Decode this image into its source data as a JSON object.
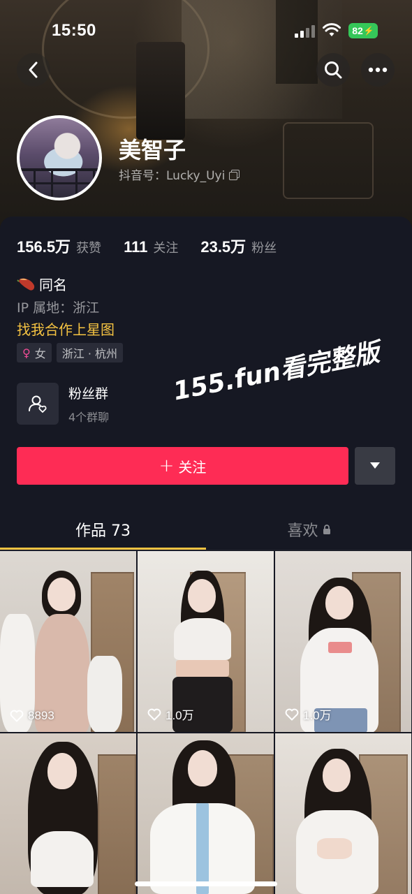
{
  "status_bar": {
    "time": "15:50",
    "battery": "82"
  },
  "profile": {
    "name": "美智子",
    "douyin_id": "抖音号：Lucky_Uyi"
  },
  "stats": [
    {
      "value": "156.5万",
      "label": "获赞"
    },
    {
      "value": "111",
      "label": "关注"
    },
    {
      "value": "23.5万",
      "label": "粉丝"
    }
  ],
  "bio": {
    "line1": "同名",
    "ip": "IP 属地：浙江",
    "collab": "找我合作上星图",
    "tags": {
      "gender": "女",
      "location": "浙江 · 杭州"
    }
  },
  "fan_group": {
    "title": "粉丝群",
    "subtitle": "4个群聊"
  },
  "watermark": "155.fun看完整版",
  "follow_button": {
    "plus": "+",
    "label": "关注"
  },
  "tabs": {
    "works": "作品 73",
    "likes": "喜欢"
  },
  "videos": [
    {
      "likes": "8893"
    },
    {
      "likes": "1.0万"
    },
    {
      "likes": "1.0万"
    },
    {
      "likes": ""
    },
    {
      "likes": ""
    },
    {
      "likes": ""
    }
  ],
  "colors": {
    "accent": "#fe2c55",
    "tab_underline": "#f5c342",
    "collab_text": "#f5c342",
    "background": "#161823",
    "battery": "#35c759"
  },
  "icons": {
    "back": "chevron-left-icon",
    "search": "search-icon",
    "more": "more-icon",
    "copy": "copy-icon",
    "fan_group": "group-icon",
    "dropdown": "triangle-down-icon",
    "lock": "lock-icon",
    "heart": "heart-icon"
  }
}
